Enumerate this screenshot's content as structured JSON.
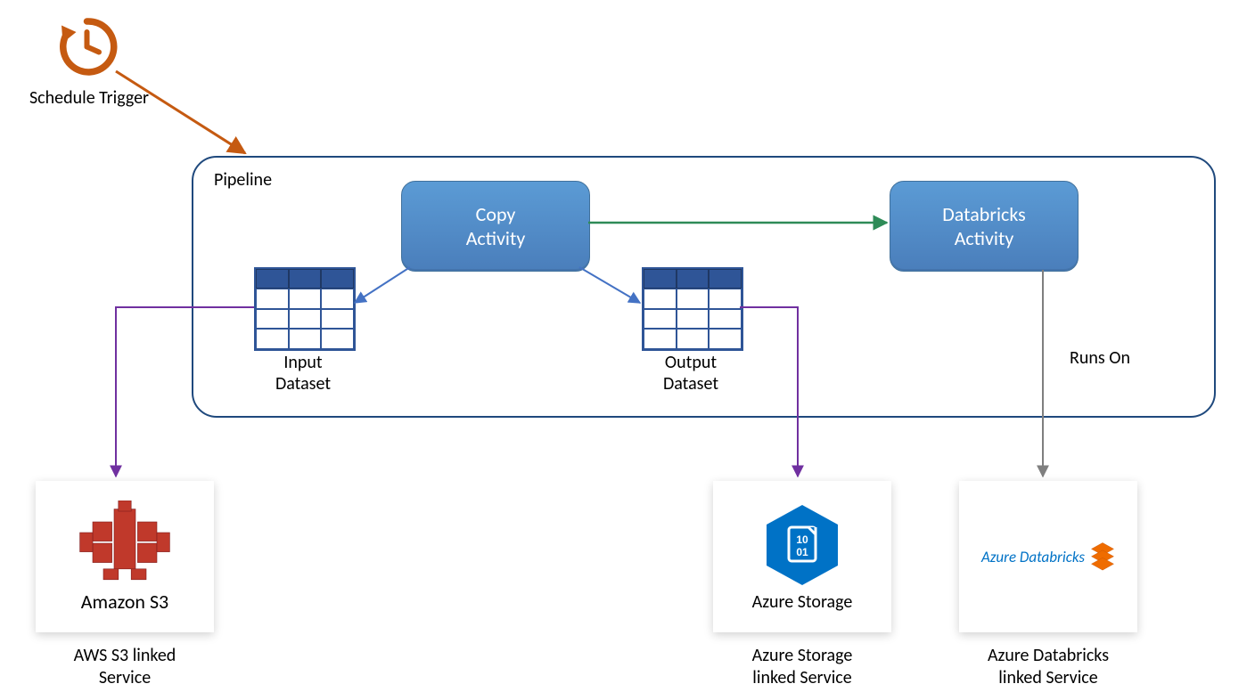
{
  "trigger_label": "Schedule Trigger",
  "pipeline_label": "Pipeline",
  "copy_activity_label": "Copy\nActivity",
  "databricks_activity_label": "Databricks\nActivity",
  "input_dataset_label": "Input\nDataset",
  "output_dataset_label": "Output\nDataset",
  "runs_on_label": "Runs On",
  "s3_tile_text": "Amazon S3",
  "s3_caption": "AWS S3 linked\nService",
  "storage_tile_text": "Azure Storage",
  "storage_caption": "Azure Storage\nlinked Service",
  "databricks_tile_text": "Azure Databricks",
  "databricks_caption": "Azure Databricks\nlinked Service",
  "colors": {
    "schedule_orange": "#c55a11",
    "pipeline_border": "#1f497d",
    "activity_fill": "#4472c4",
    "flow_blue": "#4472c4",
    "success_green": "#2e8b57",
    "link_purple": "#7030a0",
    "runs_grey": "#7f7f7f",
    "storage_blue": "#0072c6",
    "databricks_text": "#0072c6",
    "databricks_orange": "#ef6c00",
    "s3_red": "#c0392b"
  }
}
